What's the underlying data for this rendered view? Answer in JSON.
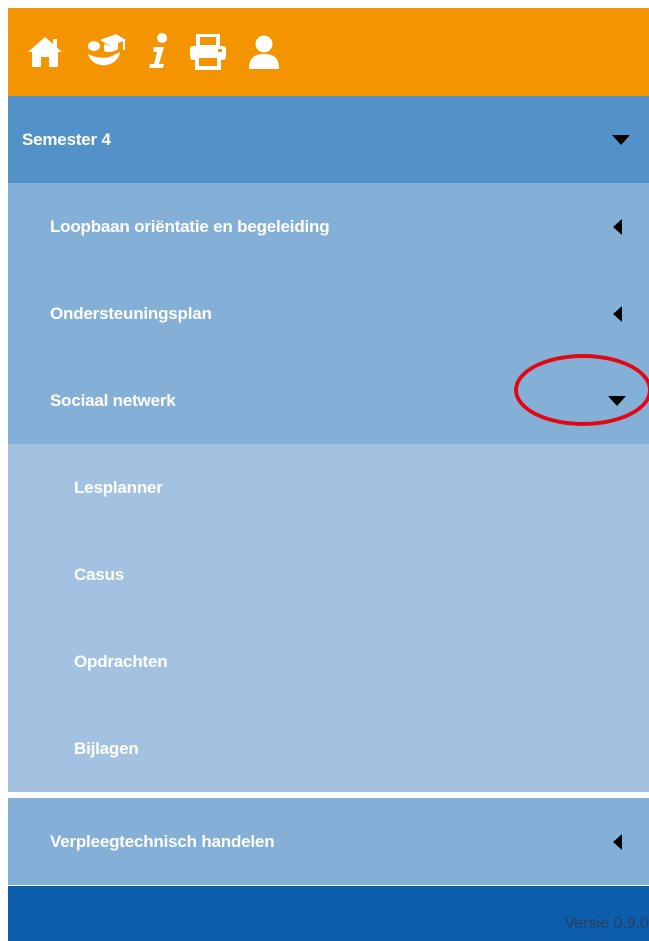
{
  "topbar": {
    "background": "#f39400",
    "icons": [
      "home-icon",
      "graduation-cap-hand-icon",
      "info-icon",
      "print-icon",
      "user-icon"
    ]
  },
  "menu": {
    "semester": {
      "label": "Semester 4",
      "state": "expanded"
    },
    "items": [
      {
        "label": "Loopbaan oriëntatie en begeleiding",
        "state": "collapsed"
      },
      {
        "label": "Ondersteuningsplan",
        "state": "collapsed"
      },
      {
        "label": "Sociaal netwerk",
        "state": "expanded"
      },
      {
        "label": "Verpleegtechnisch handelen",
        "state": "collapsed"
      }
    ],
    "subitems": [
      {
        "label": "Lesplanner"
      },
      {
        "label": "Casus"
      },
      {
        "label": "Opdrachten"
      },
      {
        "label": "Bijlagen"
      }
    ]
  },
  "footer": {
    "version": "Versie 0.9.0"
  },
  "colors": {
    "semester_bg": "#5392c9",
    "item_bg": "#84b0d8",
    "subitem_bg": "#a3c2e1",
    "footer_bg": "#0d5ead",
    "annotation": "#e30613"
  }
}
